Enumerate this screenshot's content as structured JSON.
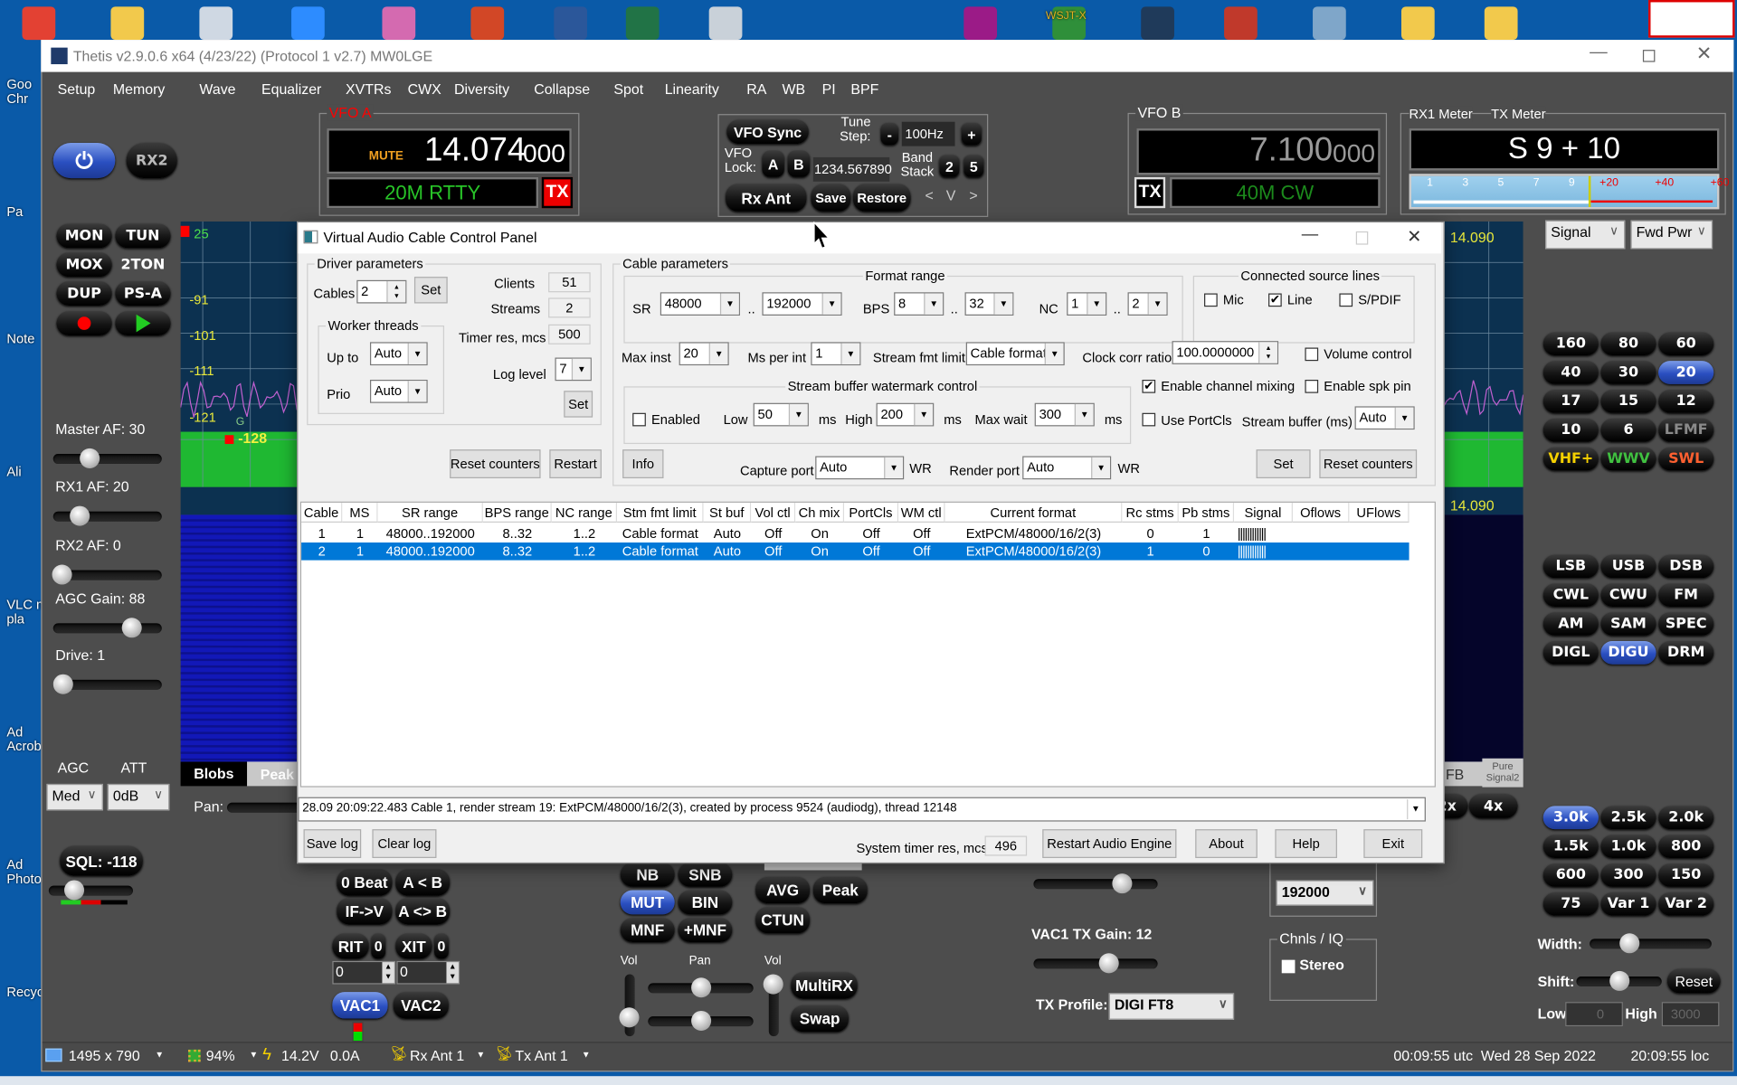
{
  "desktop": {
    "left_icon_labels": [
      "Goo\nChr",
      "Pa",
      "Note",
      "Ali",
      "VLC m\npla",
      "Ad\nAcrob",
      "Ad\nPhoto",
      "Recyc"
    ],
    "top_icon_colors": [
      "#e34133",
      "#f2c94c",
      "#cfd8e3",
      "#2d8cff",
      "#d46ab0",
      "#d24726",
      "#2b579a",
      "#217346",
      "#c9d1d9",
      "#9b1b87",
      "#2f8f3a",
      "#1f3a5a",
      "#c0392b",
      "#7fa6c9",
      "#f2c94c",
      "#f2c94c"
    ],
    "top_icon_labels": [
      "WSJT-X"
    ]
  },
  "thetis": {
    "title": "Thetis v2.9.0.6 x64 (4/23/22) (Protocol 1 v2.7) MW0LGE",
    "menu": [
      "Setup",
      "Memory",
      "Wave",
      "Equalizer",
      "XVTRs",
      "CWX",
      "Diversity",
      "Collapse",
      "Spot",
      "Linearity",
      "RA",
      "WB",
      "PI",
      "BPF"
    ],
    "rx2": "RX2",
    "vfoa": {
      "label": "VFO A",
      "mute": "MUTE",
      "freq": "14.074",
      "freq_sub": "000",
      "band_mode": "20M RTTY",
      "tx": "TX"
    },
    "vfo_ctrl": {
      "vfo_sync": "VFO Sync",
      "tune_step_label": "Tune\nStep:",
      "minus": "-",
      "tune_step": "100Hz",
      "plus": "+",
      "vfo_lock_label": "VFO\nLock:",
      "lock_a": "A",
      "lock_b": "B",
      "freq_entry": "1234.567890",
      "band_stack_label": "Band\nStack",
      "band_stack_1": "2",
      "band_stack_2": "5",
      "rx_ant": "Rx Ant",
      "save": "Save",
      "restore": "Restore",
      "prev": "<",
      "vee": "V",
      "next": ">"
    },
    "vfob": {
      "label": "VFO B",
      "freq": "7.100",
      "freq_sub": "000",
      "band_mode": "40M CW",
      "tx": "TX"
    },
    "meter": {
      "rx1_label": "RX1 Meter",
      "tx_label": "TX Meter",
      "reading": "S 9 + 10",
      "scale_white": [
        "1",
        "3",
        "5",
        "7",
        "9"
      ],
      "scale_red": [
        "+20",
        "+40",
        "+60"
      ],
      "rx_mode": "Signal",
      "tx_mode": "Fwd Pwr"
    },
    "left_buttons": [
      "MON",
      "TUN",
      "MOX",
      "2TON",
      "DUP",
      "PS-A"
    ],
    "record_icon": "record-icon",
    "play_icon": "play-icon",
    "sliders": [
      {
        "label": "Master AF:  30",
        "level": 0.3
      },
      {
        "label": "RX1 AF:  20",
        "level": 0.2
      },
      {
        "label": "RX2 AF:  0",
        "level": 0.0
      },
      {
        "label": "AGC Gain:  88",
        "level": 0.77
      },
      {
        "label": "Drive:  1",
        "level": 0.01
      }
    ],
    "agc": {
      "label": "AGC",
      "value": "Med"
    },
    "att": {
      "label": "ATT",
      "value": "0dB"
    },
    "sql": {
      "label": "SQL: -118",
      "level": 0.25
    },
    "pan_label": "Pan:",
    "display": {
      "db_labels": [
        "25",
        "-91",
        "-101",
        "-111",
        "-121"
      ],
      "noise_floor": "-128",
      "g_marker": "G",
      "freq_label": "14.090",
      "tabs": [
        "Blobs",
        "Peak"
      ],
      "right_labels": [
        "FB",
        "Pure\nSignal2"
      ],
      "zoom_buttons": [
        "2x",
        "4x"
      ]
    },
    "bands": [
      {
        "label": "160"
      },
      {
        "label": "80"
      },
      {
        "label": "60"
      },
      {
        "label": "40"
      },
      {
        "label": "30"
      },
      {
        "label": "20",
        "active": true
      },
      {
        "label": "17"
      },
      {
        "label": "15"
      },
      {
        "label": "12"
      },
      {
        "label": "10"
      },
      {
        "label": "6"
      },
      {
        "label": "LFMF",
        "color": "#8a8a8a"
      },
      {
        "label": "VHF+",
        "color": "#f5d000"
      },
      {
        "label": "WWV",
        "color": "#40c040"
      },
      {
        "label": "SWL",
        "color": "#ff6030"
      }
    ],
    "modes": [
      {
        "label": "LSB"
      },
      {
        "label": "USB"
      },
      {
        "label": "DSB"
      },
      {
        "label": "CWL"
      },
      {
        "label": "CWU"
      },
      {
        "label": "FM"
      },
      {
        "label": "AM"
      },
      {
        "label": "SAM"
      },
      {
        "label": "SPEC"
      },
      {
        "label": "DIGL"
      },
      {
        "label": "DIGU",
        "active": true
      },
      {
        "label": "DRM"
      }
    ],
    "filters": [
      {
        "label": "3.0k",
        "active": true
      },
      {
        "label": "2.5k"
      },
      {
        "label": "2.0k"
      },
      {
        "label": "1.5k"
      },
      {
        "label": "1.0k"
      },
      {
        "label": "800"
      },
      {
        "label": "600"
      },
      {
        "label": "300"
      },
      {
        "label": "150"
      },
      {
        "label": "75"
      },
      {
        "label": "Var 1"
      },
      {
        "label": "Var 2"
      }
    ],
    "filter_ctrl": {
      "width_label": "Width:",
      "width_level": 0.3,
      "shift_label": "Shift:",
      "shift_level": 0.5,
      "reset": "Reset",
      "low_label": "Low",
      "low": "0",
      "high_label": "High",
      "high": "3000"
    },
    "vfo_buttons": [
      "0 Beat",
      "A < B",
      "IF->V",
      "A <> B"
    ],
    "rit": {
      "label": "RIT",
      "value": "0",
      "entry": "0"
    },
    "xit": {
      "label": "XIT",
      "value": "0",
      "entry": "0"
    },
    "vac1": "VAC1",
    "vac2": "VAC2",
    "dsp_buttons": [
      {
        "label": "NB"
      },
      {
        "label": "SNB"
      },
      {
        "label": "MUT",
        "active": true
      },
      {
        "label": "BIN"
      },
      {
        "label": "MNF"
      },
      {
        "label": "+MNF"
      }
    ],
    "mix_labels": {
      "vol1": "Vol",
      "pan": "Pan",
      "vol2": "Vol"
    },
    "multirx": "MultiRX",
    "swap": "Swap",
    "avg": "AVG",
    "peak": "Peak",
    "ctun": "CTUN",
    "vac_gain": {
      "rx_level": 0.75,
      "tx_label": "VAC1 TX Gain: 12",
      "tx_level": 0.62
    },
    "tx_profile": {
      "label": "TX Profile:",
      "value": "DIGI FT8"
    },
    "sample_rate": {
      "value": "192000"
    },
    "chnls": {
      "label": "Chnls / IQ",
      "stereo": "Stereo",
      "stereo_checked": false
    },
    "status": {
      "resolution": "1495 x 790",
      "cpu": "94%",
      "voltage": "14.2V",
      "current": "0.0A",
      "rx_ant": "Rx Ant 1",
      "tx_ant": "Tx Ant 1",
      "utc": "00:09:55 utc  Wed 28 Sep 2022",
      "local": "20:09:55 loc"
    }
  },
  "vac": {
    "title": "Virtual Audio Cable Control Panel",
    "driver": {
      "group": "Driver parameters",
      "cables_label": "Cables",
      "cables": "2",
      "set": "Set",
      "clients_label": "Clients",
      "clients": "51",
      "streams_label": "Streams",
      "streams": "2",
      "timer_label": "Timer res, mcs",
      "timer": "500",
      "worker_group": "Worker threads",
      "upto_label": "Up to",
      "upto": "Auto",
      "prio_label": "Prio",
      "prio": "Auto",
      "log_level_label": "Log level",
      "log_level": "7",
      "set2": "Set",
      "reset_counters": "Reset counters",
      "restart": "Restart"
    },
    "cable": {
      "group": "Cable parameters",
      "format_group": "Format range",
      "sr_label": "SR",
      "sr_min": "48000",
      "sr_max": "192000",
      "dots": "..",
      "bps_label": "BPS",
      "bps_min": "8",
      "bps_max": "32",
      "nc_label": "NC",
      "nc_min": "1",
      "nc_max": "2",
      "source_group": "Connected source lines",
      "mic": "Mic",
      "mic_checked": false,
      "line": "Line",
      "line_checked": true,
      "spdif": "S/PDIF",
      "spdif_checked": false,
      "max_inst_label": "Max inst",
      "max_inst": "20",
      "ms_per_int_label": "Ms per int",
      "ms_per_int": "1",
      "stream_fmt_label": "Stream fmt limit",
      "stream_fmt": "Cable format",
      "clock_label": "Clock corr ratio",
      "clock": "100.0000000",
      "volume_control": "Volume control",
      "volume_checked": false,
      "wm_group": "Stream buffer watermark control",
      "enabled": "Enabled",
      "enabled_checked": false,
      "low_label": "Low",
      "low": "50",
      "ms": "ms",
      "high_label": "High",
      "high": "200",
      "max_wait_label": "Max wait",
      "max_wait": "300",
      "channel_mixing": "Enable channel mixing",
      "channel_mixing_checked": true,
      "spk_pin": "Enable spk pin",
      "spk_pin_checked": false,
      "portcls": "Use PortCls",
      "portcls_checked": false,
      "stream_buffer_label": "Stream buffer (ms)",
      "stream_buffer": "Auto",
      "info": "Info",
      "capture_label": "Capture port",
      "capture": "Auto",
      "wr": "WR",
      "render_label": "Render port",
      "render": "Auto",
      "set": "Set",
      "reset_counters": "Reset counters"
    },
    "table": {
      "columns": [
        "Cable",
        "MS",
        "SR range",
        "BPS range",
        "NC range",
        "Stm fmt limit",
        "St buf",
        "Vol ctl",
        "Ch mix",
        "PortCls",
        "WM ctl",
        "Current format",
        "Rc stms",
        "Pb stms",
        "Signal",
        "Oflows",
        "UFlows"
      ],
      "rows": [
        [
          "1",
          "1",
          "48000..192000",
          "8..32",
          "1..2",
          "Cable format",
          "Auto",
          "Off",
          "On",
          "Off",
          "Off",
          "ExtPCM/48000/16/2(3)",
          "0",
          "1",
          "||||||||||||",
          "",
          ""
        ],
        [
          "2",
          "1",
          "48000..192000",
          "8..32",
          "1..2",
          "Cable format",
          "Auto",
          "Off",
          "On",
          "Off",
          "Off",
          "ExtPCM/48000/16/2(3)",
          "1",
          "0",
          "||||||||||||",
          "",
          ""
        ]
      ],
      "selected_row": 1
    },
    "log": "28.09 20:09:22.483 Cable 1, render stream 19: ExtPCM/48000/16/2(3), created by process 9524 (audiodg), thread 12148",
    "bottom": {
      "save_log": "Save log",
      "clear_log": "Clear log",
      "timer_label": "System timer res, mcs",
      "timer": "496",
      "restart_engine": "Restart Audio Engine",
      "about": "About",
      "help": "Help",
      "exit": "Exit"
    }
  },
  "colors": {
    "accent_blue": "#0078d7",
    "thetis_bg": "#4d4d4d",
    "desktop": "#0a5aa8",
    "spectrum_green": "#1fb832",
    "label_yellow": "#e8e83a"
  }
}
